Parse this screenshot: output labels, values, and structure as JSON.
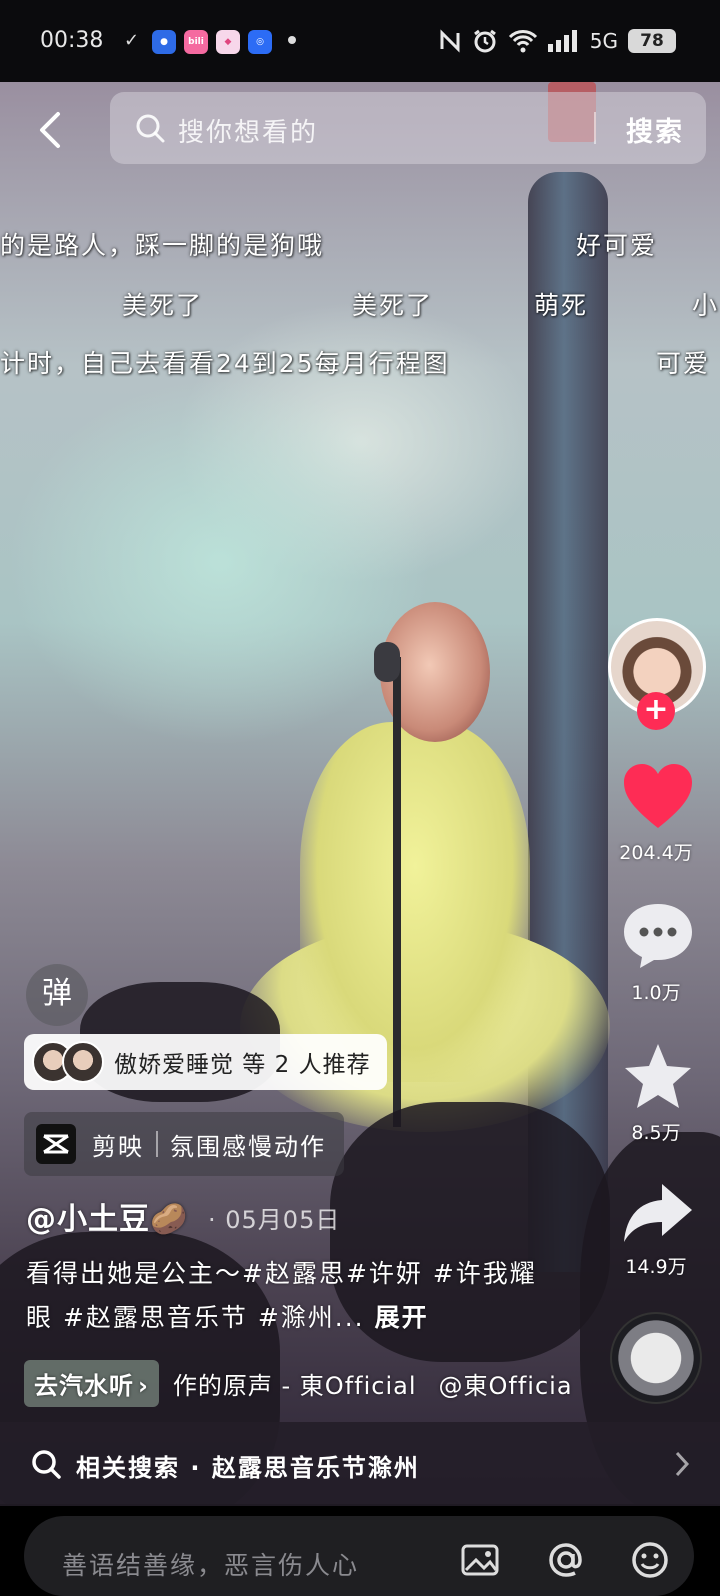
{
  "status_bar": {
    "time": "00:38",
    "network": "5G",
    "battery": "78",
    "apps": [
      "baidu",
      "bilibili",
      "douyin-mall",
      "browser"
    ]
  },
  "search": {
    "placeholder": "搜你想看的",
    "button": "搜索"
  },
  "danmaku": [
    "的是路人，踩一脚的是狗哦",
    "好可爱",
    "美死了",
    "美死了",
    "萌死",
    "小",
    "计时，自己去看看24到25每月行程图",
    "可爱"
  ],
  "rail": {
    "likes": "204.4万",
    "comments": "1.0万",
    "favorites": "8.5万",
    "shares": "14.9万"
  },
  "danmu_toggle": "弹",
  "recommend": {
    "text": "傲娇爱睡觉 等 2 人推荐"
  },
  "capcut": {
    "app": "剪映",
    "template": "氛围感慢动作"
  },
  "post": {
    "author": "@小土豆🥔",
    "date": "· 05月05日",
    "caption": "看得出她是公主～#赵露思#许妍 #许我耀眼 #赵露思音乐节 #滁州...",
    "expand": "展开"
  },
  "music": {
    "chip": "去汽水听",
    "title": "作的原声 - 東Official",
    "at": "@東Officia"
  },
  "related": {
    "text": "相关搜索 · 赵露思音乐节滁州"
  },
  "comment": {
    "placeholder": "善语结善缘，恶言伤人心"
  },
  "colors": {
    "like": "#fe2c55",
    "follow": "#fe2c55"
  }
}
